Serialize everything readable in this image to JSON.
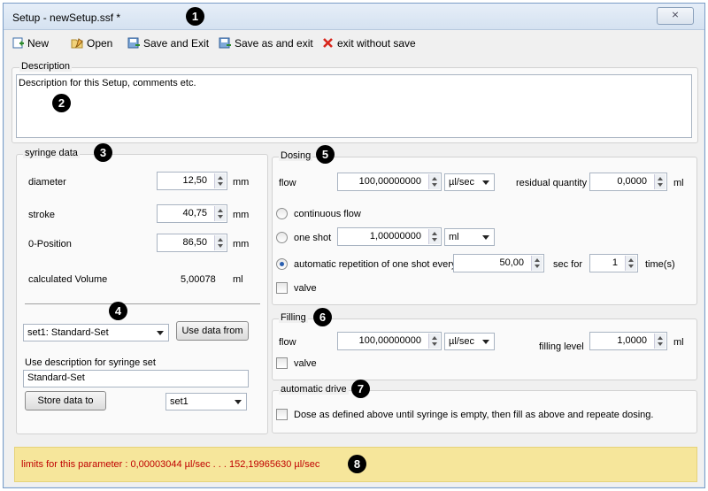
{
  "window": {
    "title": "Setup - newSetup.ssf *",
    "close_label": "⨯"
  },
  "markers": [
    "1",
    "2",
    "3",
    "4",
    "5",
    "6",
    "7",
    "8"
  ],
  "toolbar": {
    "new": "New",
    "open": "Open",
    "save_exit": "Save and Exit",
    "save_as_exit": "Save as and exit",
    "exit_no_save": "exit without save"
  },
  "description": {
    "label": "Description",
    "value": "Description for this Setup, comments etc."
  },
  "syringe": {
    "label": "syringe data",
    "diameter_label": "diameter",
    "diameter_value": "12,50",
    "diameter_unit": "mm",
    "stroke_label": "stroke",
    "stroke_value": "40,75",
    "stroke_unit": "mm",
    "zero_label": "0-Position",
    "zero_value": "86,50",
    "zero_unit": "mm",
    "volume_label": "calculated Volume",
    "volume_value": "5,00078",
    "volume_unit": "ml",
    "set_select": "set1: Standard-Set",
    "use_data_button": "Use data from",
    "use_desc_label": "Use description for syringe set",
    "set_desc_value": "Standard-Set",
    "store_button": "Store data to",
    "store_select": "set1"
  },
  "dosing": {
    "label": "Dosing",
    "flow_label": "flow",
    "flow_value": "100,00000000",
    "flow_unit": "µl/sec",
    "residual_label": "residual quantity",
    "residual_value": "0,0000",
    "residual_unit": "ml",
    "continuous_label": "continuous flow",
    "oneshot_label": "one shot",
    "oneshot_value": "1,00000000",
    "oneshot_unit": "ml",
    "auto_label": "automatic repetition of one shot every",
    "auto_value": "50,00",
    "sec_for_label": "sec for",
    "times_value": "1",
    "times_label": "time(s)",
    "valve_label": "valve"
  },
  "filling": {
    "label": "Filling",
    "flow_label": "flow",
    "flow_value": "100,00000000",
    "flow_unit": "µl/sec",
    "level_label": "filling level",
    "level_value": "1,0000",
    "level_unit": "ml",
    "valve_label": "valve"
  },
  "auto_drive": {
    "label": "automatic drive",
    "check_label": "Dose as defined above until syringe is empty, then fill as above and repeate dosing."
  },
  "status": {
    "text": "limits for this parameter : 0,00003044 µl/sec . . . 152,19965630 µl/sec",
    "color": "#c00000"
  }
}
